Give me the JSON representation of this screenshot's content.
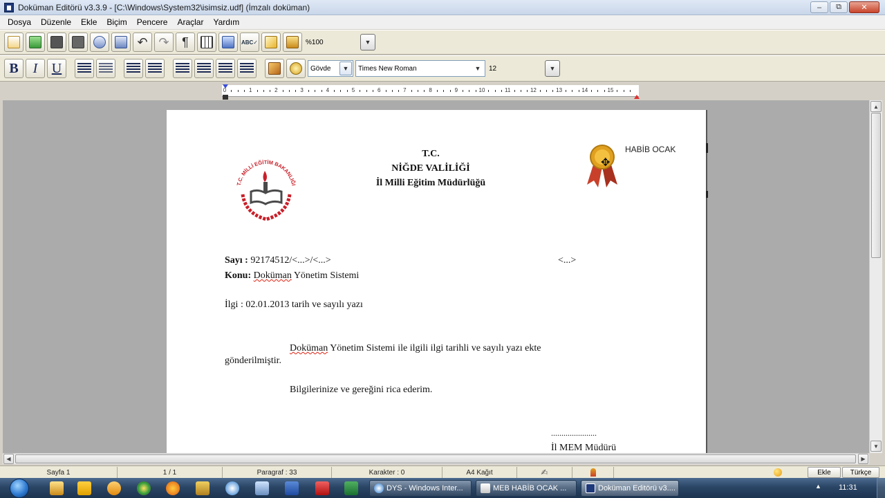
{
  "window": {
    "title": "Doküman Editörü v3.3.9 - [C:\\Windows\\System32\\isimsiz.udf] (İmzalı doküman)"
  },
  "menu": [
    {
      "label": "Dosya"
    },
    {
      "label": "Düzenle"
    },
    {
      "label": "Ekle"
    },
    {
      "label": "Biçim"
    },
    {
      "label": "Pencere"
    },
    {
      "label": "Araçlar"
    },
    {
      "label": "Yardım"
    }
  ],
  "toolbar": {
    "zoom_value": "%100",
    "style_value": "Gövde",
    "font_value": "Times New Roman",
    "size_value": "12",
    "bold_glyph": "B",
    "italic_glyph": "I",
    "underline_glyph": "U"
  },
  "ruler": {
    "labels": [
      "0",
      "1",
      "2",
      "3",
      "4",
      "5",
      "6",
      "7",
      "8",
      "9",
      "10",
      "11",
      "12",
      "13",
      "14",
      "15"
    ]
  },
  "document": {
    "header_line1": "T.C.",
    "header_line2": "NİĞDE VALİLİĞİ",
    "header_line3": "İl Milli Eğitim Müdürlüğü",
    "emblem_text": "T.C. MİLLİ EĞİTİM BAKANLIĞI",
    "signer_name": "HABİB OCAK",
    "sayi_label": "Sayı  :",
    "sayi_value": "92174512/<...>/<...>",
    "date_placeholder": "<...>",
    "konu_label": "Konu:",
    "konu_word1": "Doküman",
    "konu_rest": " Yönetim Sistemi",
    "ilgi": "İlgi : 02.01.2013 tarih ve sayılı yazı",
    "body1_word1": "Doküman",
    "body1_rest": " Yönetim Sistemi ile ilgili ilgi tarihli ve sayılı yazı ekte",
    "body1_line2": "gönderilmiştir.",
    "body2": "Bilgilerinize ve gereğini rica ederim.",
    "sign_dots": "......................",
    "sign_title": "İl MEM Müdürü"
  },
  "status": {
    "page": "Sayfa 1",
    "pages": "1 / 1",
    "paragraph": "Paragraf : 33",
    "characters": "Karakter : 0",
    "paper": "A4 Kağıt",
    "insert_mode": "Ekle",
    "language": "Türkçe"
  },
  "taskbar": {
    "tasks": [
      {
        "label": "DYS - Windows Inter..."
      },
      {
        "label": "MEB  HABİB OCAK ..."
      },
      {
        "label": "Doküman Editörü v3...."
      }
    ],
    "clock": "11:31"
  },
  "colors": {
    "accent": "#1f3a7a",
    "emblem_red": "#c8202a",
    "seal_gold": "#e0a020"
  }
}
